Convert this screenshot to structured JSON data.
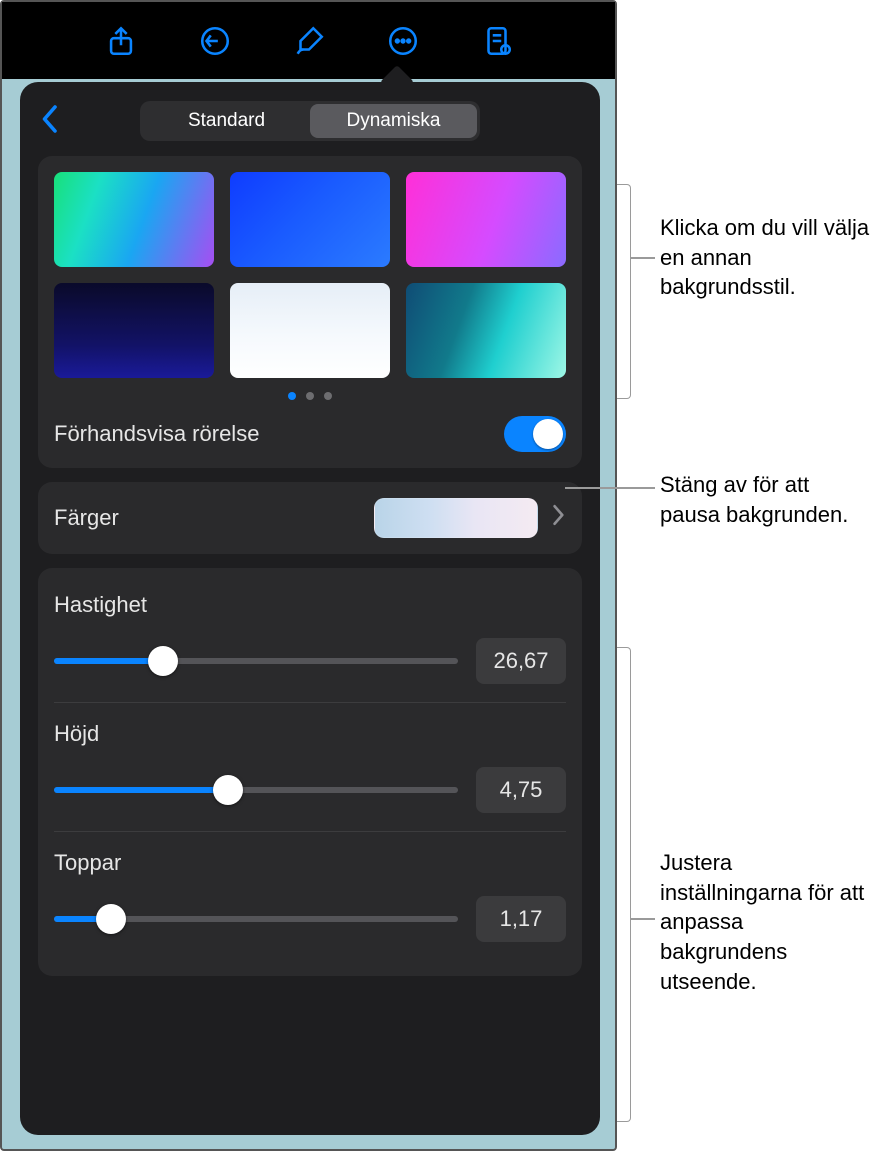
{
  "segmented": {
    "standard": "Standard",
    "dynamic": "Dynamiska",
    "active": 1
  },
  "preview_motion": {
    "label": "Förhandsvisa rörelse",
    "on": true
  },
  "colors": {
    "label": "Färger"
  },
  "sliders": {
    "speed": {
      "label": "Hastighet",
      "value": "26,67",
      "percent": 27
    },
    "height": {
      "label": "Höjd",
      "value": "4,75",
      "percent": 43
    },
    "peaks": {
      "label": "Toppar",
      "value": "1,17",
      "percent": 14
    }
  },
  "callouts": {
    "pick_style": "Klicka om du vill välja en annan bakgrundsstil.",
    "pause_bg": "Stäng av för att pausa bakgrunden.",
    "adjust": "Justera inställningarna för att anpassa bakgrundens utseende."
  },
  "thumb_styles": [
    "linear-gradient(110deg,#18e07a 0%,#1be0c4 25%,#1aa6f2 55%,#a64ef2 100%)",
    "linear-gradient(135deg,#0f3cff 0%,#1a5bff 45%,#2b7bff 100%)",
    "linear-gradient(110deg,#ff2fd8 0%,#d54bff 55%,#8a6bff 100%)",
    "linear-gradient(180deg,#0a0a2a 0%,#121266 65%,#1a1a99 100%)",
    "linear-gradient(180deg,#e6eef7 0%,#f5f9fd 55%,#ffffff 100%)",
    "linear-gradient(110deg,#0f4c75 0%,#117a8b 35%,#1fcfcf 60%,#9ef7e6 100%)"
  ]
}
